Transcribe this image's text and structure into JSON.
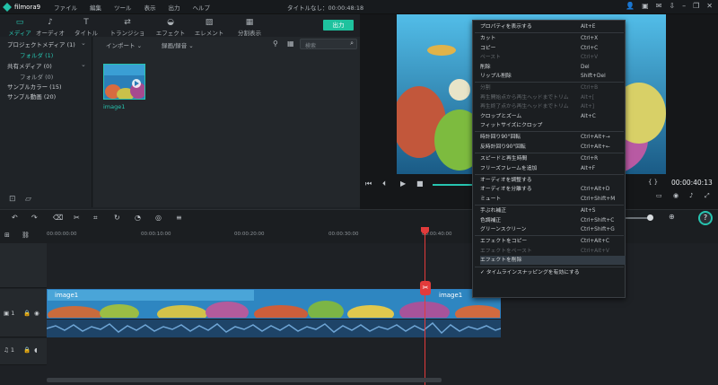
{
  "app": {
    "name": "filmora9",
    "window_title": "タイトルなし：00:00:48:18"
  },
  "menu": [
    "ファイル",
    "編集",
    "ツール",
    "表示",
    "出力",
    "ヘルプ"
  ],
  "tabs": [
    {
      "label": "メディア",
      "icon": "folder-icon",
      "active": true
    },
    {
      "label": "オーディオ",
      "icon": "music-icon",
      "active": false
    },
    {
      "label": "タイトル",
      "icon": "text-icon",
      "active": false
    },
    {
      "label": "トランジション",
      "icon": "transition-icon",
      "active": false
    },
    {
      "label": "エフェクト",
      "icon": "effect-icon",
      "active": false
    },
    {
      "label": "エレメント",
      "icon": "element-icon",
      "active": false
    },
    {
      "label": "分割表示",
      "icon": "split-screen-icon",
      "active": false
    }
  ],
  "export_label": "出力",
  "tree": [
    {
      "label": "プロジェクトメディア (1)",
      "sub": false,
      "selected": false
    },
    {
      "label": "フォルダ (1)",
      "sub": true,
      "selected": true
    },
    {
      "label": "共有メディア (0)",
      "sub": false,
      "selected": false
    },
    {
      "label": "フォルダ (0)",
      "sub": true,
      "selected": false
    },
    {
      "label": "サンプルカラー (15)",
      "sub": false,
      "selected": false
    },
    {
      "label": "サンプル動画 (20)",
      "sub": false,
      "selected": false
    }
  ],
  "media_toolbar": {
    "import": "インポート",
    "record": "録画/録音",
    "search_placeholder": "検索"
  },
  "media_item": {
    "name": "image1"
  },
  "timecode": "00:00:40:13",
  "ruler_ticks": [
    "00:00:00:00",
    "00:00:10:00",
    "00:00:20:00",
    "00:00:30:00",
    "00:00:40:00"
  ],
  "clip_labels": [
    "image1",
    "image1"
  ],
  "context_menu": {
    "groups": [
      [
        {
          "label": "プロパティを表示する",
          "shortcut": "Alt+E",
          "disabled": false
        }
      ],
      [
        {
          "label": "カット",
          "shortcut": "Ctrl+X",
          "disabled": false
        },
        {
          "label": "コピー",
          "shortcut": "Ctrl+C",
          "disabled": false
        },
        {
          "label": "ペースト",
          "shortcut": "Ctrl+V",
          "disabled": true
        },
        {
          "label": "削除",
          "shortcut": "Del",
          "disabled": false
        },
        {
          "label": "リップル削除",
          "shortcut": "Shift+Del",
          "disabled": false
        }
      ],
      [
        {
          "label": "分割",
          "shortcut": "Ctrl+B",
          "disabled": true
        },
        {
          "label": "再生開始点から再生ヘッドまでトリム",
          "shortcut": "Alt+[",
          "disabled": true
        },
        {
          "label": "再生終了点から再生ヘッドまでトリム",
          "shortcut": "Alt+]",
          "disabled": true
        },
        {
          "label": "クロップとズーム",
          "shortcut": "Alt+C",
          "disabled": false
        },
        {
          "label": "フィットサイズにクロップ",
          "shortcut": "",
          "disabled": false
        }
      ],
      [
        {
          "label": "時計回り90°回転",
          "shortcut": "Ctrl+Alt+→",
          "disabled": false
        },
        {
          "label": "反時計回り90°回転",
          "shortcut": "Ctrl+Alt+←",
          "disabled": false
        }
      ],
      [
        {
          "label": "スピードと再生時間",
          "shortcut": "Ctrl+R",
          "disabled": false
        },
        {
          "label": "フリーズフレームを追加",
          "shortcut": "Alt+F",
          "disabled": false
        }
      ],
      [
        {
          "label": "オーディオを調整する",
          "shortcut": "",
          "disabled": false
        },
        {
          "label": "オーディオを分離する",
          "shortcut": "Ctrl+Alt+D",
          "disabled": false
        },
        {
          "label": "ミュート",
          "shortcut": "Ctrl+Shift+M",
          "disabled": false
        }
      ],
      [
        {
          "label": "手ぶれ補正",
          "shortcut": "Alt+S",
          "disabled": false
        },
        {
          "label": "色調補正",
          "shortcut": "Ctrl+Shift+C",
          "disabled": false
        },
        {
          "label": "グリーンスクリーン",
          "shortcut": "Ctrl+Shift+G",
          "disabled": false
        }
      ],
      [
        {
          "label": "エフェクトをコピー",
          "shortcut": "Ctrl+Alt+C",
          "disabled": false
        },
        {
          "label": "エフェクトをペースト",
          "shortcut": "Ctrl+Alt+V",
          "disabled": true
        },
        {
          "label": "エフェクトを削除",
          "shortcut": "",
          "disabled": false,
          "highlighted": true
        }
      ],
      [
        {
          "label": "タイムラインスナッピングを有効にする",
          "shortcut": "",
          "disabled": false,
          "checked": true
        }
      ]
    ]
  },
  "track_labels": {
    "video": "1",
    "audio": "1"
  },
  "colors": {
    "accent": "#27c4b0",
    "playhead": "#e23b3b",
    "export": "#1ec29e"
  }
}
